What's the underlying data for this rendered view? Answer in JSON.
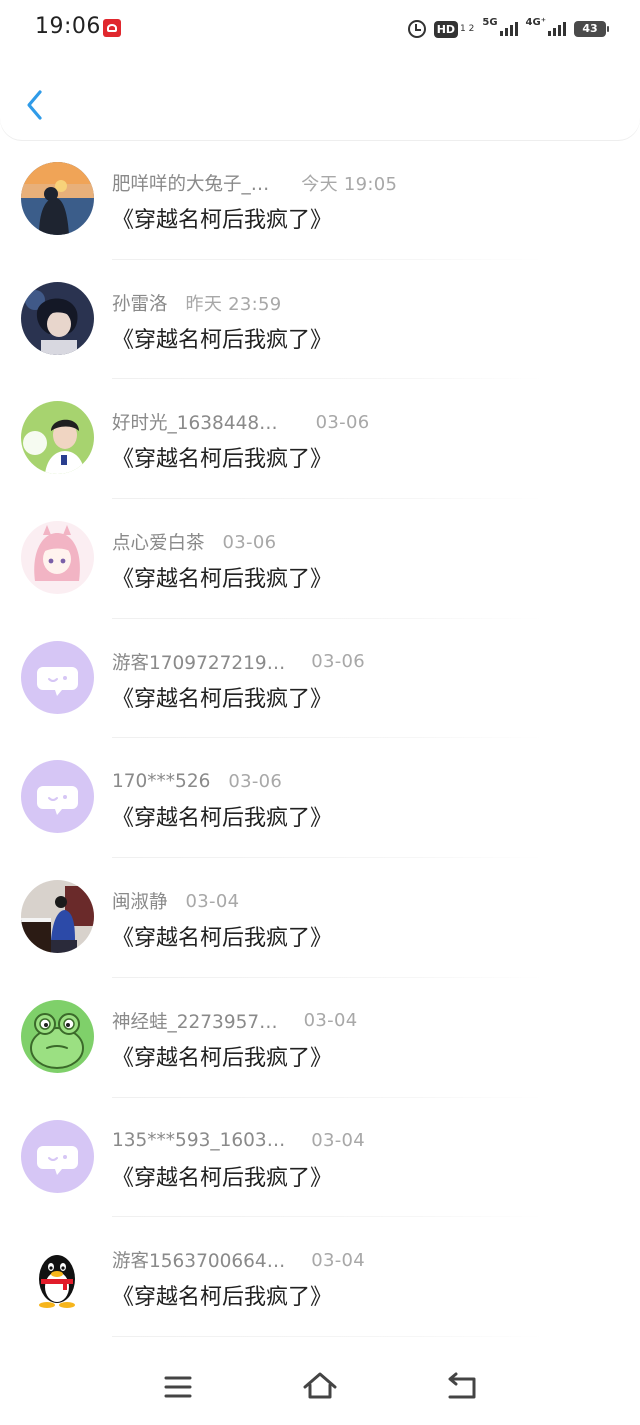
{
  "status_bar": {
    "time": "19:06",
    "hd_label": "HD",
    "hd_sub": "1 2",
    "net1": "5G",
    "net2": "4G⁺",
    "battery": "43"
  },
  "header": {
    "back_icon": "chevron-left-icon"
  },
  "messages": [
    {
      "name": "肥咩咩的大兔子_…",
      "time": "今天 19:05",
      "title": "《穿越名柯后我疯了》"
    },
    {
      "name": "孙雷洛",
      "time": "昨天 23:59",
      "title": "《穿越名柯后我疯了》"
    },
    {
      "name": "好时光_1638448…",
      "time": "03-06",
      "title": "《穿越名柯后我疯了》"
    },
    {
      "name": "点心爱白茶",
      "time": "03-06",
      "title": "《穿越名柯后我疯了》"
    },
    {
      "name": "游客1709727219…",
      "time": "03-06",
      "title": "《穿越名柯后我疯了》"
    },
    {
      "name": "170***526",
      "time": "03-06",
      "title": "《穿越名柯后我疯了》"
    },
    {
      "name": "闽淑静",
      "time": "03-04",
      "title": "《穿越名柯后我疯了》"
    },
    {
      "name": "神经蛙_2273957…",
      "time": "03-04",
      "title": "《穿越名柯后我疯了》"
    },
    {
      "name": "135***593_1603…",
      "time": "03-04",
      "title": "《穿越名柯后我疯了》"
    },
    {
      "name": "游客1563700664…",
      "time": "03-04",
      "title": "《穿越名柯后我疯了》"
    }
  ],
  "nav": {
    "menu_icon": "menu-icon",
    "home_icon": "home-icon",
    "back_icon": "back-icon"
  },
  "colors": {
    "accent": "#2f9be8",
    "default_avatar": "#d6c6f5"
  }
}
